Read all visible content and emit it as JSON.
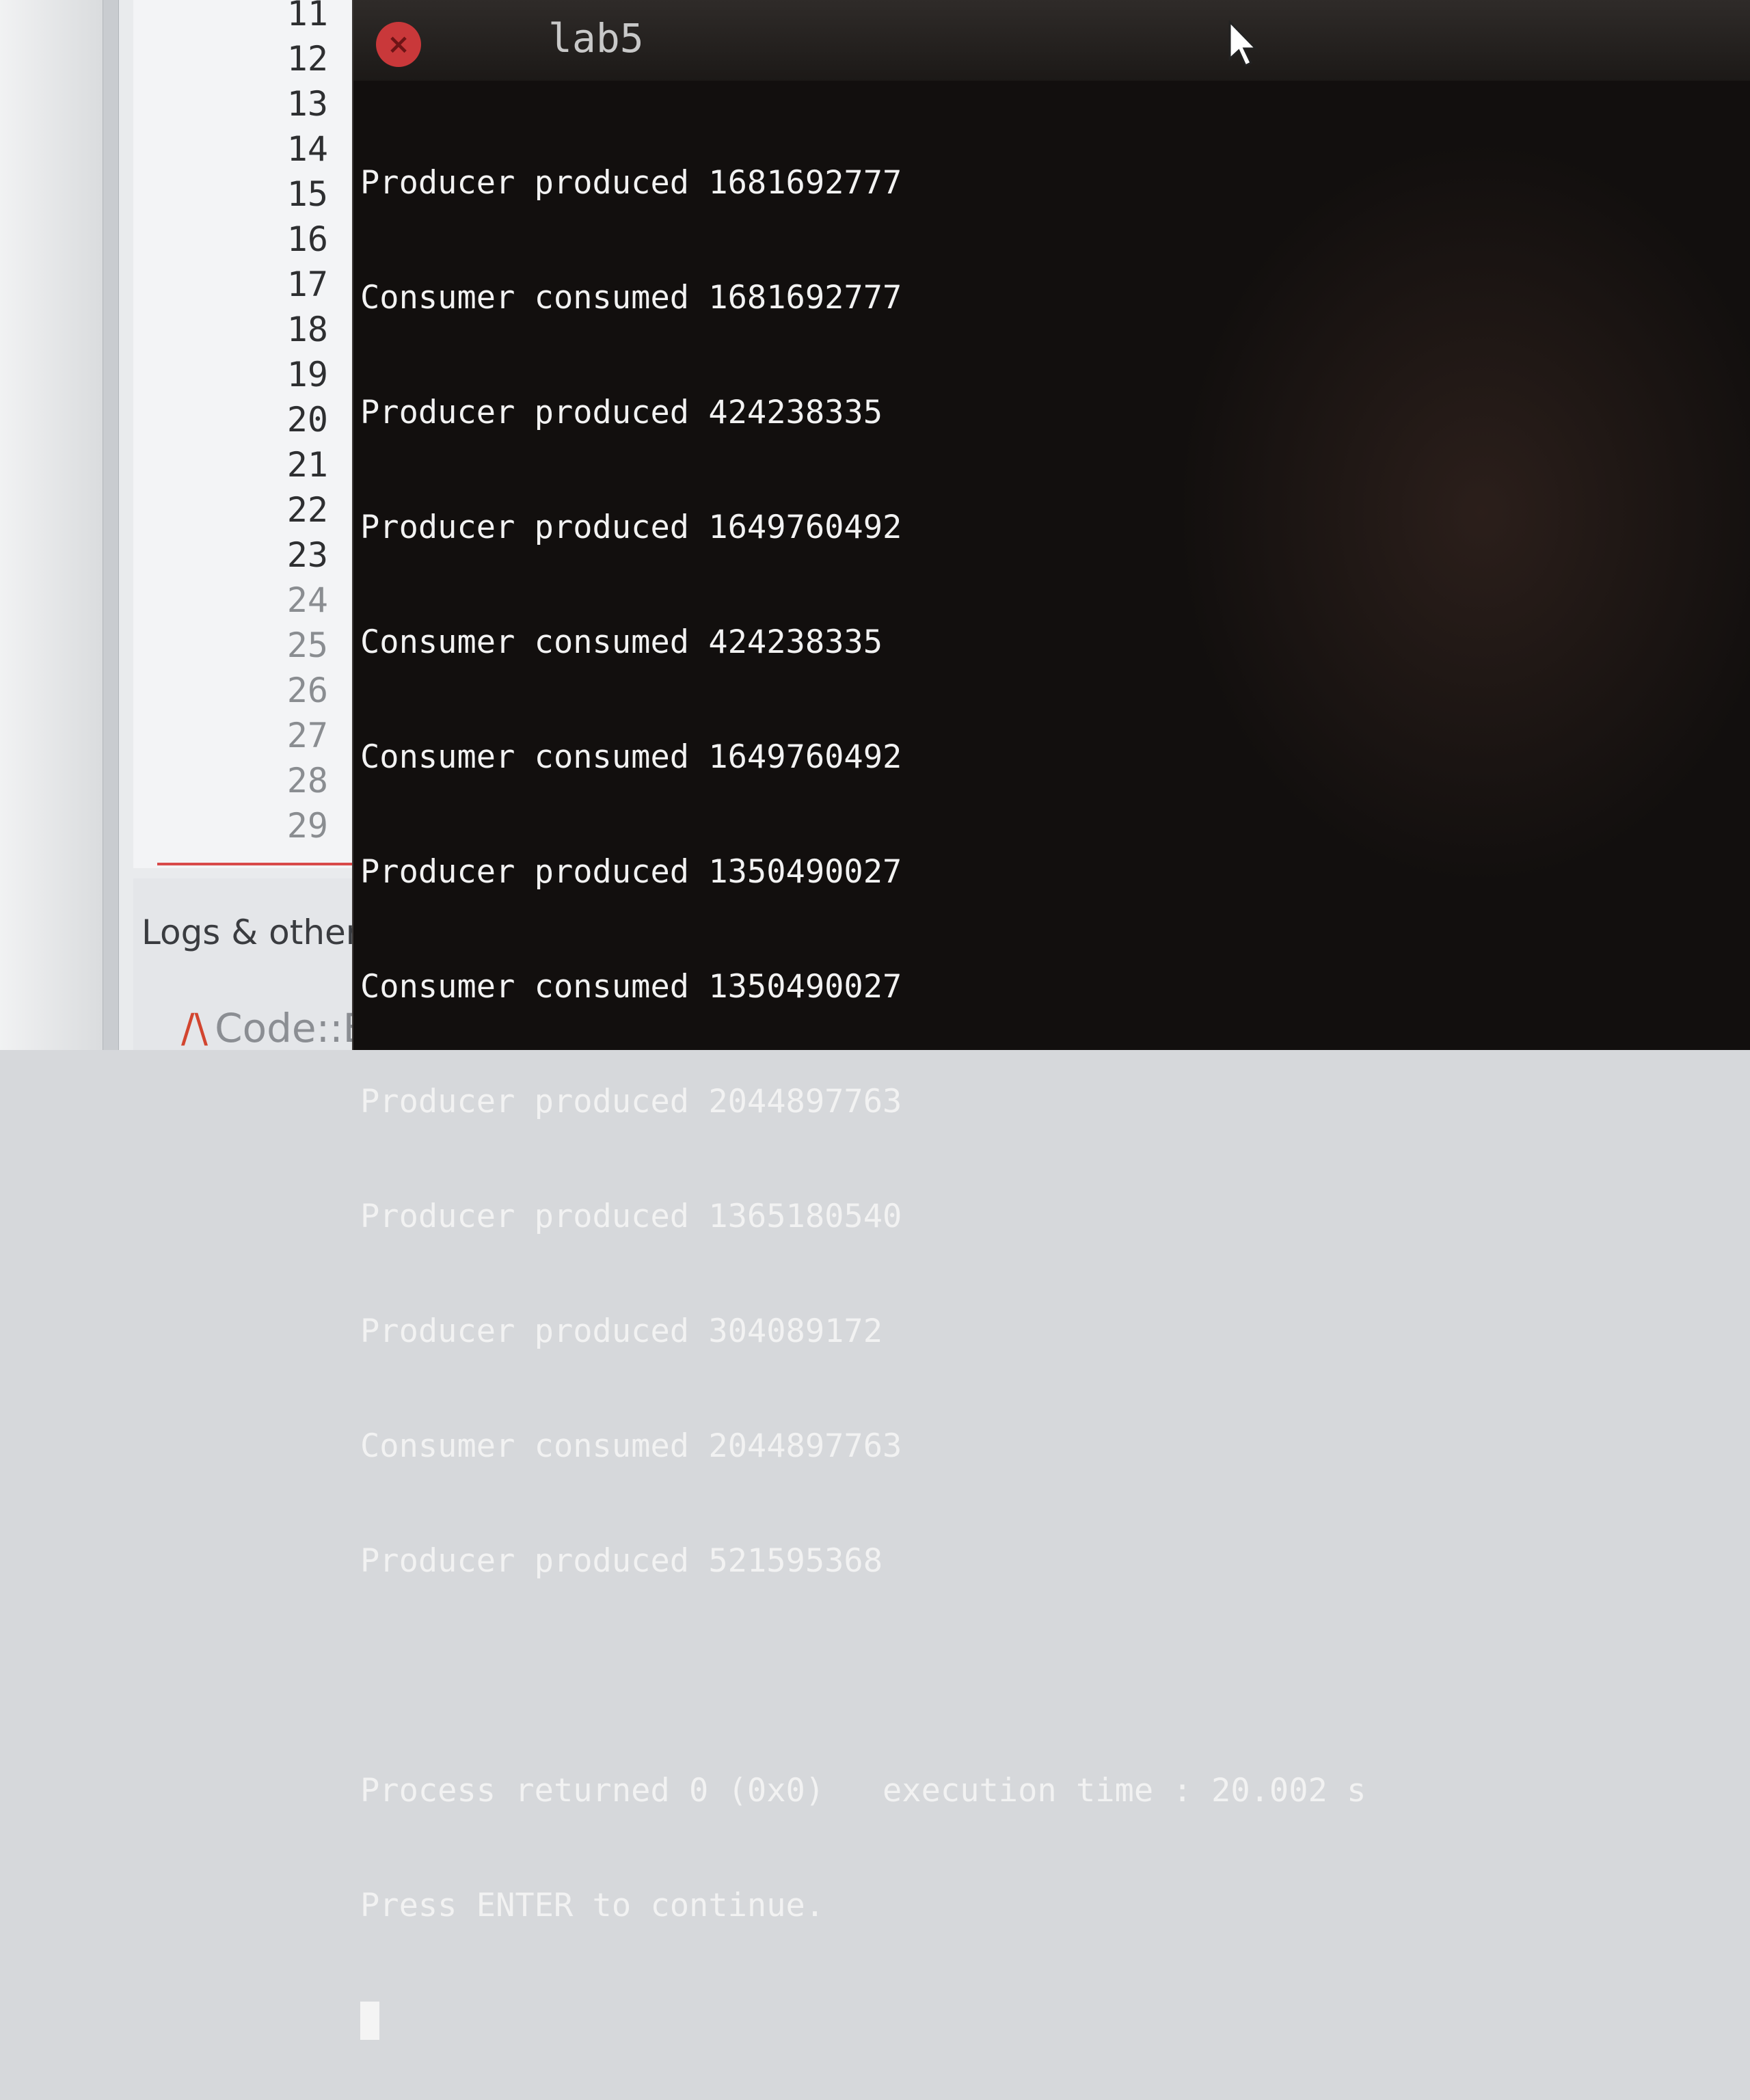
{
  "ide": {
    "line_numbers": [
      "11",
      "12",
      "13",
      "14",
      "15",
      "16",
      "17",
      "18",
      "19",
      "20",
      "21",
      "22",
      "23",
      "24",
      "25",
      "26",
      "27",
      "28",
      "29"
    ],
    "logs_tab_label": "Logs & others",
    "codeblocks_tab_label": "Code::B"
  },
  "terminal": {
    "title": "lab5",
    "output_lines": [
      "Producer produced 1681692777",
      "Consumer consumed 1681692777",
      "Producer produced 424238335",
      "Producer produced 1649760492",
      "Consumer consumed 424238335",
      "Consumer consumed 1649760492",
      "Producer produced 1350490027",
      "Consumer consumed 1350490027",
      "Producer produced 2044897763",
      "Producer produced 1365180540",
      "Producer produced 304089172",
      "Consumer consumed 2044897763",
      "Producer produced 521595368"
    ],
    "status_line": "Process returned 0 (0x0)   execution time : 20.002 s",
    "prompt_line": "Press ENTER to continue."
  },
  "colors": {
    "terminal_background": "#120f0e",
    "terminal_text": "#f2f2f2",
    "close_button": "#c9383a"
  }
}
